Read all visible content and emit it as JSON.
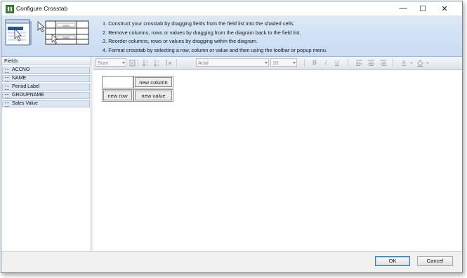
{
  "window": {
    "title": "Configure Crosstab",
    "minimize_glyph": "—",
    "maximize_glyph": "☐",
    "close_glyph": "✕"
  },
  "banner": {
    "illustration_labels": [
      "Sales",
      "Sales"
    ],
    "instructions": [
      "1. Construct your crosstab by dragging fields from the field list into the shaded cells.",
      "2. Remove columns, rows or values by dragging from the diagram back to the field list.",
      "3. Reorder columns, rows or values by dragging within the diagram.",
      "4. Format crosstab by selecting a row, column or value and then using the toolbar or popup menu."
    ]
  },
  "fields": {
    "header": "Fields",
    "items": [
      "ACCNO",
      "NAME",
      "Period Label",
      "GROUPNAME",
      "Sales Value"
    ]
  },
  "toolbar": {
    "aggregate_value": "Sum",
    "font_value": "Arial",
    "size_value": "10",
    "bold_glyph": "B",
    "italic_glyph": "I",
    "underline_glyph": "U",
    "font_color_glyph": "A",
    "icons": [
      "properties-icon",
      "sort-ascending-icon",
      "sort-descending-icon",
      "clear-sort-icon",
      "bold-icon",
      "italic-icon",
      "underline-icon",
      "align-left-icon",
      "align-center-icon",
      "align-right-icon",
      "font-color-icon",
      "fill-color-icon"
    ]
  },
  "crosstab": {
    "column_label": "new column",
    "row_label": "new row",
    "value_label": "new value"
  },
  "footer": {
    "ok_label": "OK",
    "cancel_label": "Cancel"
  }
}
